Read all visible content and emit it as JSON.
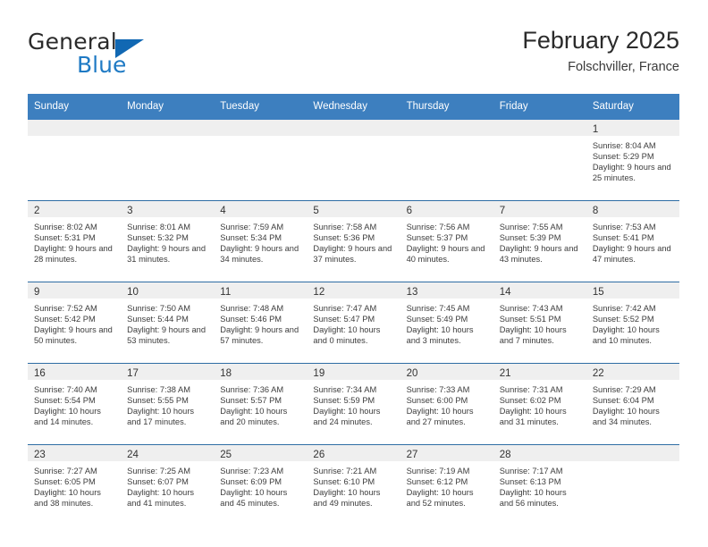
{
  "brand": {
    "name_top": "General",
    "name_bottom": "Blue",
    "triangle_color": "#1168b3",
    "blue_text_color": "#1f7ac4"
  },
  "header": {
    "title": "February 2025",
    "subtitle": "Folschviller, France"
  },
  "theme": {
    "header_blue": "#3d7fbf",
    "row_divider_blue": "#2e6da4",
    "daynum_band": "#efefef"
  },
  "calendar": {
    "weekday_headers": [
      "Sunday",
      "Monday",
      "Tuesday",
      "Wednesday",
      "Thursday",
      "Friday",
      "Saturday"
    ],
    "weeks": [
      [
        {
          "day": "",
          "empty": true
        },
        {
          "day": "",
          "empty": true
        },
        {
          "day": "",
          "empty": true
        },
        {
          "day": "",
          "empty": true
        },
        {
          "day": "",
          "empty": true
        },
        {
          "day": "",
          "empty": true
        },
        {
          "day": "1",
          "sunrise": "Sunrise: 8:04 AM",
          "sunset": "Sunset: 5:29 PM",
          "daylight": "Daylight: 9 hours and 25 minutes."
        }
      ],
      [
        {
          "day": "2",
          "sunrise": "Sunrise: 8:02 AM",
          "sunset": "Sunset: 5:31 PM",
          "daylight": "Daylight: 9 hours and 28 minutes."
        },
        {
          "day": "3",
          "sunrise": "Sunrise: 8:01 AM",
          "sunset": "Sunset: 5:32 PM",
          "daylight": "Daylight: 9 hours and 31 minutes."
        },
        {
          "day": "4",
          "sunrise": "Sunrise: 7:59 AM",
          "sunset": "Sunset: 5:34 PM",
          "daylight": "Daylight: 9 hours and 34 minutes."
        },
        {
          "day": "5",
          "sunrise": "Sunrise: 7:58 AM",
          "sunset": "Sunset: 5:36 PM",
          "daylight": "Daylight: 9 hours and 37 minutes."
        },
        {
          "day": "6",
          "sunrise": "Sunrise: 7:56 AM",
          "sunset": "Sunset: 5:37 PM",
          "daylight": "Daylight: 9 hours and 40 minutes."
        },
        {
          "day": "7",
          "sunrise": "Sunrise: 7:55 AM",
          "sunset": "Sunset: 5:39 PM",
          "daylight": "Daylight: 9 hours and 43 minutes."
        },
        {
          "day": "8",
          "sunrise": "Sunrise: 7:53 AM",
          "sunset": "Sunset: 5:41 PM",
          "daylight": "Daylight: 9 hours and 47 minutes."
        }
      ],
      [
        {
          "day": "9",
          "sunrise": "Sunrise: 7:52 AM",
          "sunset": "Sunset: 5:42 PM",
          "daylight": "Daylight: 9 hours and 50 minutes."
        },
        {
          "day": "10",
          "sunrise": "Sunrise: 7:50 AM",
          "sunset": "Sunset: 5:44 PM",
          "daylight": "Daylight: 9 hours and 53 minutes."
        },
        {
          "day": "11",
          "sunrise": "Sunrise: 7:48 AM",
          "sunset": "Sunset: 5:46 PM",
          "daylight": "Daylight: 9 hours and 57 minutes."
        },
        {
          "day": "12",
          "sunrise": "Sunrise: 7:47 AM",
          "sunset": "Sunset: 5:47 PM",
          "daylight": "Daylight: 10 hours and 0 minutes."
        },
        {
          "day": "13",
          "sunrise": "Sunrise: 7:45 AM",
          "sunset": "Sunset: 5:49 PM",
          "daylight": "Daylight: 10 hours and 3 minutes."
        },
        {
          "day": "14",
          "sunrise": "Sunrise: 7:43 AM",
          "sunset": "Sunset: 5:51 PM",
          "daylight": "Daylight: 10 hours and 7 minutes."
        },
        {
          "day": "15",
          "sunrise": "Sunrise: 7:42 AM",
          "sunset": "Sunset: 5:52 PM",
          "daylight": "Daylight: 10 hours and 10 minutes."
        }
      ],
      [
        {
          "day": "16",
          "sunrise": "Sunrise: 7:40 AM",
          "sunset": "Sunset: 5:54 PM",
          "daylight": "Daylight: 10 hours and 14 minutes."
        },
        {
          "day": "17",
          "sunrise": "Sunrise: 7:38 AM",
          "sunset": "Sunset: 5:55 PM",
          "daylight": "Daylight: 10 hours and 17 minutes."
        },
        {
          "day": "18",
          "sunrise": "Sunrise: 7:36 AM",
          "sunset": "Sunset: 5:57 PM",
          "daylight": "Daylight: 10 hours and 20 minutes."
        },
        {
          "day": "19",
          "sunrise": "Sunrise: 7:34 AM",
          "sunset": "Sunset: 5:59 PM",
          "daylight": "Daylight: 10 hours and 24 minutes."
        },
        {
          "day": "20",
          "sunrise": "Sunrise: 7:33 AM",
          "sunset": "Sunset: 6:00 PM",
          "daylight": "Daylight: 10 hours and 27 minutes."
        },
        {
          "day": "21",
          "sunrise": "Sunrise: 7:31 AM",
          "sunset": "Sunset: 6:02 PM",
          "daylight": "Daylight: 10 hours and 31 minutes."
        },
        {
          "day": "22",
          "sunrise": "Sunrise: 7:29 AM",
          "sunset": "Sunset: 6:04 PM",
          "daylight": "Daylight: 10 hours and 34 minutes."
        }
      ],
      [
        {
          "day": "23",
          "sunrise": "Sunrise: 7:27 AM",
          "sunset": "Sunset: 6:05 PM",
          "daylight": "Daylight: 10 hours and 38 minutes."
        },
        {
          "day": "24",
          "sunrise": "Sunrise: 7:25 AM",
          "sunset": "Sunset: 6:07 PM",
          "daylight": "Daylight: 10 hours and 41 minutes."
        },
        {
          "day": "25",
          "sunrise": "Sunrise: 7:23 AM",
          "sunset": "Sunset: 6:09 PM",
          "daylight": "Daylight: 10 hours and 45 minutes."
        },
        {
          "day": "26",
          "sunrise": "Sunrise: 7:21 AM",
          "sunset": "Sunset: 6:10 PM",
          "daylight": "Daylight: 10 hours and 49 minutes."
        },
        {
          "day": "27",
          "sunrise": "Sunrise: 7:19 AM",
          "sunset": "Sunset: 6:12 PM",
          "daylight": "Daylight: 10 hours and 52 minutes."
        },
        {
          "day": "28",
          "sunrise": "Sunrise: 7:17 AM",
          "sunset": "Sunset: 6:13 PM",
          "daylight": "Daylight: 10 hours and 56 minutes."
        },
        {
          "day": "",
          "empty": true
        }
      ]
    ]
  }
}
